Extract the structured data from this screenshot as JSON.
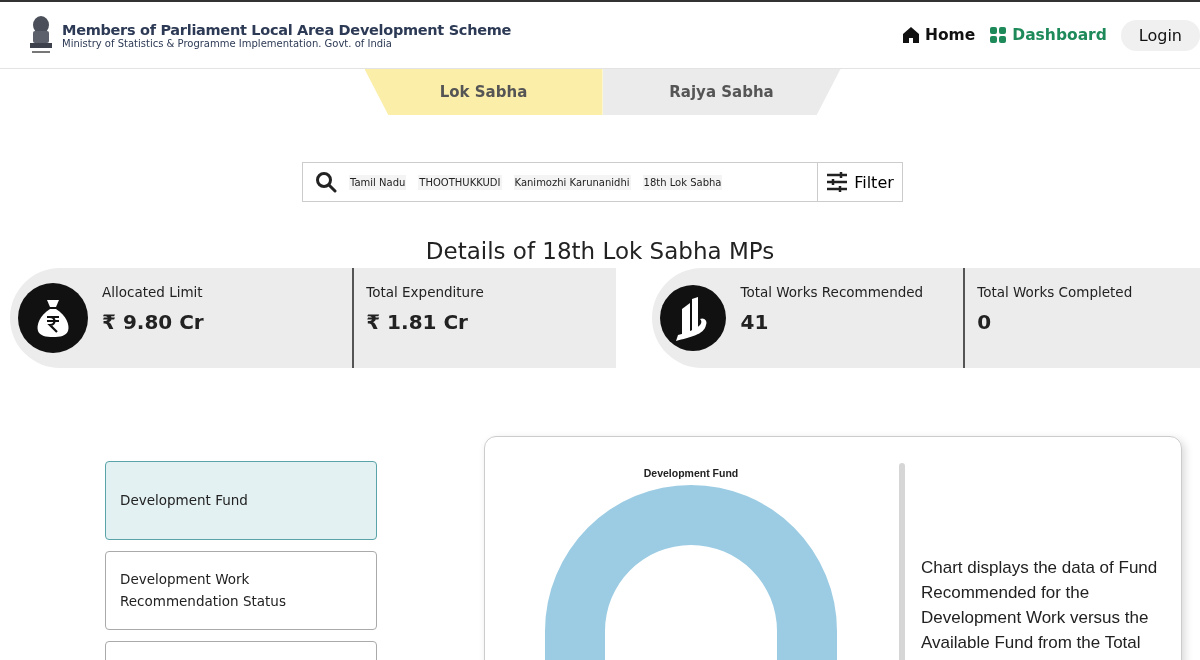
{
  "header": {
    "title": "Members of Parliament Local Area Development Scheme",
    "subtitle": "Ministry of Statistics & Programme Implementation. Govt. of India",
    "nav": [
      {
        "label": "Home",
        "kind": "home",
        "selected": false
      },
      {
        "label": "Dashboard",
        "kind": "dashboard",
        "selected": true
      }
    ],
    "login": "Login"
  },
  "tabs": [
    {
      "label": "Lok Sabha",
      "selected": true
    },
    {
      "label": "Rajya Sabha",
      "selected": false
    }
  ],
  "search": {
    "chips": [
      "Tamil Nadu",
      "THOOTHUKKUDI",
      "Kanimozhi Karunanidhi",
      "18th Lok Sabha"
    ],
    "filter": "Filter"
  },
  "heading": "Details of 18th Lok Sabha MPs",
  "stat_groups": [
    {
      "kind": "money",
      "stats": [
        {
          "label": "Allocated Limit",
          "value": "₹ 9.80 Cr"
        },
        {
          "label": "Total Expenditure",
          "value": "₹ 1.81 Cr"
        }
      ]
    },
    {
      "kind": "works",
      "stats": [
        {
          "label": "Total Works Recommended",
          "value": "41"
        },
        {
          "label": "Total Works Completed",
          "value": "0"
        }
      ]
    }
  ],
  "menu": [
    {
      "label": "Development Fund",
      "selected": true
    },
    {
      "label": "Development Work Recommendation Status",
      "selected": false
    }
  ],
  "chart_panel": {
    "title": "Development Fund",
    "description": "Chart displays the data of Fund Recommended for the Development Work versus the Available Fund from the Total"
  }
}
